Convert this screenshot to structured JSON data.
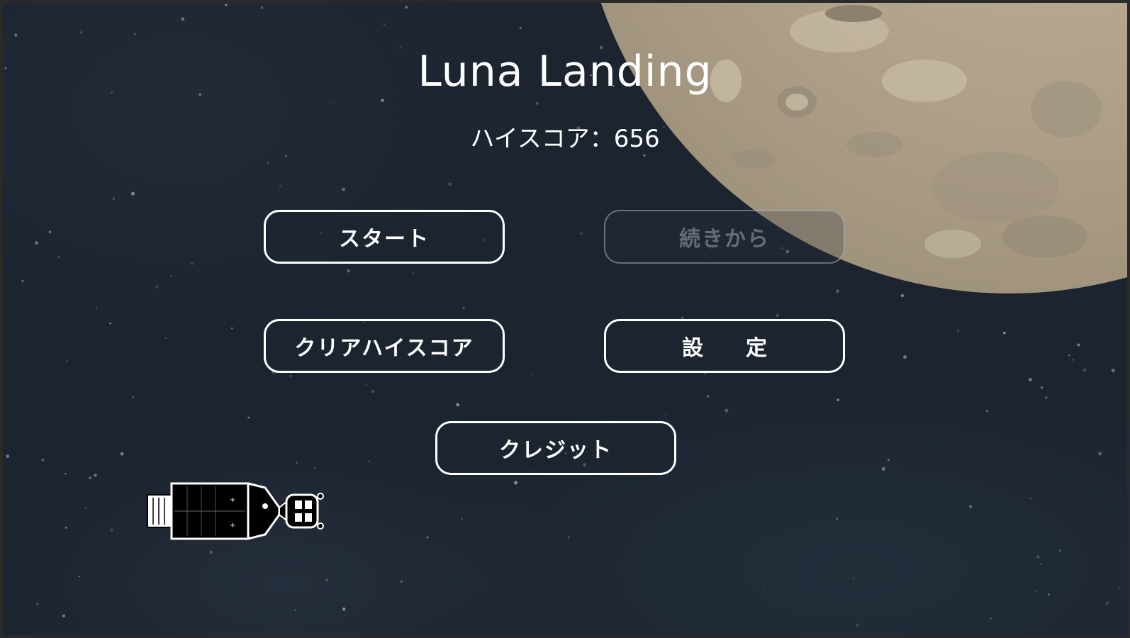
{
  "game": {
    "title": "Luna Landing",
    "high_score_label": "ハイスコア：656",
    "high_score_value": 656
  },
  "menu": {
    "start_label": "スタート",
    "continue_label": "続きから",
    "clear_high_score_label": "クリアハイスコア",
    "settings_label": "設定",
    "credits_label": "クレジット"
  },
  "colors": {
    "background": "#1c2430",
    "text": "#ffffff",
    "moon": "#b8ab94",
    "disabled": "#c8cdd4"
  },
  "icons": {
    "moon": "moon-icon",
    "spacecraft": "spacecraft-icon"
  }
}
